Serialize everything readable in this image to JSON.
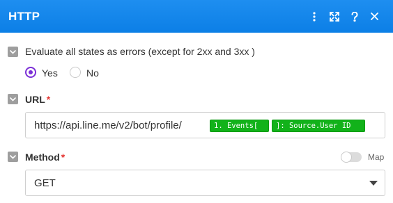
{
  "header": {
    "title": "HTTP",
    "actions": [
      "more-icon",
      "expand-icon",
      "help-icon",
      "close-icon"
    ],
    "bg_color": "#1883ea"
  },
  "evaluate": {
    "label": "Evaluate all states as errors (except for 2xx and 3xx )",
    "options": [
      {
        "label": "Yes",
        "selected": true
      },
      {
        "label": "No",
        "selected": false
      }
    ]
  },
  "url": {
    "label": "URL",
    "required_mark": "*",
    "value_text": "https://api.line.me/v2/bot/profile/",
    "tokens": [
      "1. Events[",
      "]: Source.User ID"
    ],
    "token_color": "#12b21a"
  },
  "method": {
    "label": "Method",
    "required_mark": "*",
    "map_label": "Map",
    "map_enabled": false,
    "selected": "GET"
  },
  "colors": {
    "radio_accent": "#7b2fd6",
    "required": "#e53935"
  }
}
